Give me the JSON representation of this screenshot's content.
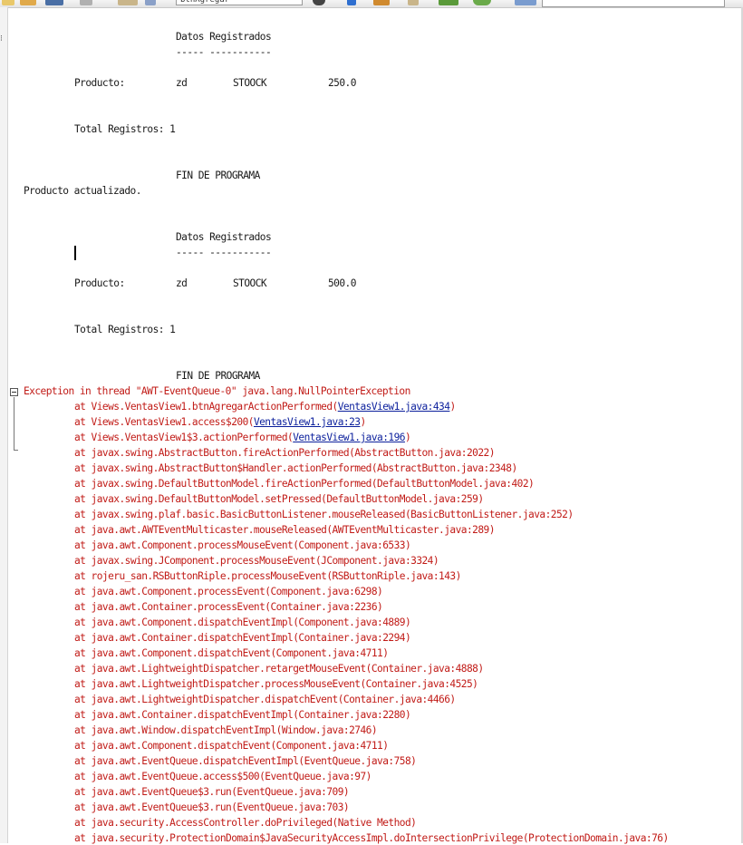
{
  "toolbar": {
    "combo_value": "btnAgregar"
  },
  "output": {
    "block1": {
      "header": "Datos Registrados",
      "underline": "----- -----------",
      "row_label": "Producto:",
      "row_name": "zd",
      "row_field": "STOOCK",
      "row_value": "250.0",
      "total": "Total Registros: 1",
      "end": "FIN DE PROGRAMA"
    },
    "status_message": "Producto actualizado.",
    "block2": {
      "header": "Datos Registrados",
      "underline": "----- -----------",
      "row_label": "Producto:",
      "row_name": "zd",
      "row_field": "STOOCK",
      "row_value": "500.0",
      "total": "Total Registros: 1",
      "end": "FIN DE PROGRAMA"
    },
    "exception": "Exception in thread \"AWT-EventQueue-0\" java.lang.NullPointerException",
    "linked_frames": [
      {
        "prefix": "at Views.VentasView1.btnAgregarActionPerformed(",
        "link": "VentasView1.java:434",
        "suffix": ")"
      },
      {
        "prefix": "at Views.VentasView1.access$200(",
        "link": "VentasView1.java:23",
        "suffix": ")"
      },
      {
        "prefix": "at Views.VentasView1$3.actionPerformed(",
        "link": "VentasView1.java:196",
        "suffix": ")"
      }
    ],
    "frames": [
      "at javax.swing.AbstractButton.fireActionPerformed(AbstractButton.java:2022)",
      "at javax.swing.AbstractButton$Handler.actionPerformed(AbstractButton.java:2348)",
      "at javax.swing.DefaultButtonModel.fireActionPerformed(DefaultButtonModel.java:402)",
      "at javax.swing.DefaultButtonModel.setPressed(DefaultButtonModel.java:259)",
      "at javax.swing.plaf.basic.BasicButtonListener.mouseReleased(BasicButtonListener.java:252)",
      "at java.awt.AWTEventMulticaster.mouseReleased(AWTEventMulticaster.java:289)",
      "at java.awt.Component.processMouseEvent(Component.java:6533)",
      "at javax.swing.JComponent.processMouseEvent(JComponent.java:3324)",
      "at rojeru_san.RSButtonRiple.processMouseEvent(RSButtonRiple.java:143)",
      "at java.awt.Component.processEvent(Component.java:6298)",
      "at java.awt.Container.processEvent(Container.java:2236)",
      "at java.awt.Component.dispatchEventImpl(Component.java:4889)",
      "at java.awt.Container.dispatchEventImpl(Container.java:2294)",
      "at java.awt.Component.dispatchEvent(Component.java:4711)",
      "at java.awt.LightweightDispatcher.retargetMouseEvent(Container.java:4888)",
      "at java.awt.LightweightDispatcher.processMouseEvent(Container.java:4525)",
      "at java.awt.LightweightDispatcher.dispatchEvent(Container.java:4466)",
      "at java.awt.Container.dispatchEventImpl(Container.java:2280)",
      "at java.awt.Window.dispatchEventImpl(Window.java:2746)",
      "at java.awt.Component.dispatchEvent(Component.java:4711)",
      "at java.awt.EventQueue.dispatchEventImpl(EventQueue.java:758)",
      "at java.awt.EventQueue.access$500(EventQueue.java:97)",
      "at java.awt.EventQueue$3.run(EventQueue.java:709)",
      "at java.awt.EventQueue$3.run(EventQueue.java:703)",
      "at java.security.AccessController.doPrivileged(Native Method)",
      "at java.security.ProtectionDomain$JavaSecurityAccessImpl.doIntersectionPrivilege(ProtectionDomain.java:76)"
    ],
    "colors": {
      "error": "#c11b17",
      "link": "#0b1f9c",
      "text": "#1a1a1a"
    }
  }
}
